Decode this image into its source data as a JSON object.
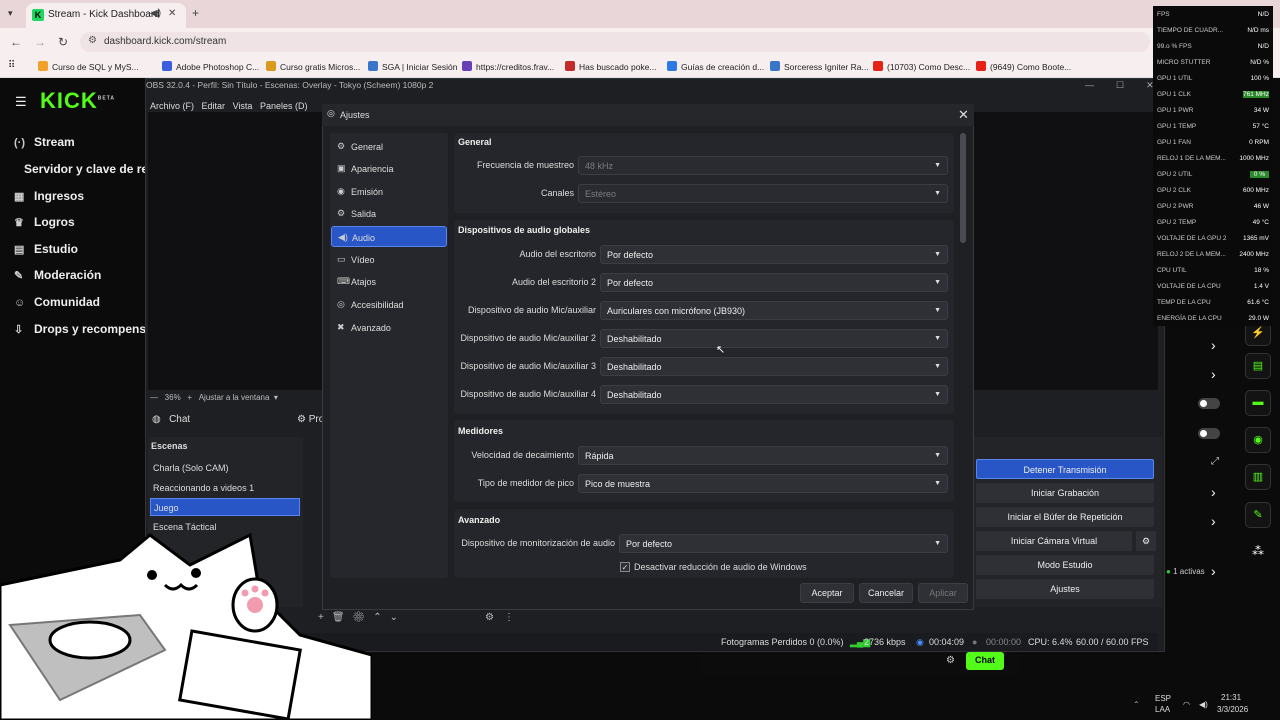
{
  "browser": {
    "tab_title": "Stream - Kick Dashboard",
    "tab_icon": "kick-favicon",
    "url": "dashboard.kick.com/stream",
    "bookmarks": [
      {
        "label": "Curso de SQL y MyS...",
        "color": "#f2a22a"
      },
      {
        "label": "Adobe Photoshop C...",
        "color": "#3b5fdc"
      },
      {
        "label": "Curso gratis Micros...",
        "color": "#d99a1e"
      },
      {
        "label": "SGA | Iniciar Sesión",
        "color": "#3a76c8"
      },
      {
        "label": "https://creditos.frav...",
        "color": "#6a3fb5"
      },
      {
        "label": "Has buscado poke...",
        "color": "#c32a2a"
      },
      {
        "label": "Guías de creación d...",
        "color": "#2c7be5"
      },
      {
        "label": "Sorceress Igniter Ra...",
        "color": "#3a76c8"
      },
      {
        "label": "(10703) Como Desc...",
        "color": "#e62117"
      },
      {
        "label": "(9649) Como Boote...",
        "color": "#e62117"
      }
    ]
  },
  "kick": {
    "logo": "KICK",
    "beta": "BETA",
    "nav": [
      {
        "icon": "stream-icon",
        "glyph": "(·)",
        "label": "Stream"
      },
      {
        "icon": "key-icon",
        "glyph": "",
        "label": "Servidor y clave de retra"
      },
      {
        "icon": "revenue-icon",
        "glyph": "▦",
        "label": "Ingresos"
      },
      {
        "icon": "trophy-icon",
        "glyph": "♛",
        "label": "Logros"
      },
      {
        "icon": "studio-icon",
        "glyph": "▤",
        "label": "Estudio"
      },
      {
        "icon": "wrench-icon",
        "glyph": "✎",
        "label": "Moderación"
      },
      {
        "icon": "community-icon",
        "glyph": "☺",
        "label": "Comunidad"
      },
      {
        "icon": "drops-icon",
        "glyph": "⇩",
        "label": "Drops y recompensas"
      }
    ]
  },
  "obs": {
    "title": "OBS 32.0.4 - Perfil: Sin Título - Escenas: Overlay - Tokyo (Scheem) 1080p 2",
    "menu": [
      "Archivo (F)",
      "Editar",
      "Vista",
      "Paneles (D)"
    ],
    "zoom_text": "36%",
    "fit_text": "Ajustar a la ventana",
    "chat_dock": "Chat",
    "props_dock": "Pro",
    "scenes_header": "Escenas",
    "scenes": [
      "Charla (Solo CAM)",
      "Reaccionando a videos 1",
      "Juego",
      "Escena Táctical"
    ],
    "active_scene": "Juego",
    "controls": [
      "Detener Transmisión",
      "Iniciar Grabación",
      "Iniciar el Búfer de Repetición",
      "Iniciar Cámara Virtual",
      "Modo Estudio",
      "Ajustes"
    ],
    "status": {
      "dropped": "Fotogramas Perdidos 0 (0.0%)",
      "bitrate": "2736 kbps",
      "stream_time": "00:04:09",
      "rec_time": "00:00:00",
      "cpu": "CPU: 6.4%",
      "fps": "60.00 / 60.00 FPS"
    },
    "chat_button": "Chat",
    "active_count": "1 activas"
  },
  "dialog": {
    "title": "Ajustes",
    "sidebar": [
      {
        "icon": "gear-icon",
        "glyph": "⚙",
        "label": "General"
      },
      {
        "icon": "appearance-icon",
        "glyph": "▣",
        "label": "Apariencia"
      },
      {
        "icon": "broadcast-icon",
        "glyph": "◉",
        "label": "Emisión"
      },
      {
        "icon": "output-icon",
        "glyph": "⚙",
        "label": "Salida"
      },
      {
        "icon": "speaker-icon",
        "glyph": "◀)",
        "label": "Audio"
      },
      {
        "icon": "monitor-icon",
        "glyph": "▭",
        "label": "Vídeo"
      },
      {
        "icon": "keyboard-icon",
        "glyph": "⌨",
        "label": "Atajos"
      },
      {
        "icon": "accessibility-icon",
        "glyph": "◎",
        "label": "Accesibilidad"
      },
      {
        "icon": "tools-icon",
        "glyph": "✖",
        "label": "Avanzado"
      }
    ],
    "active_item": "Audio",
    "general": {
      "header": "General",
      "sample_rate_label": "Frecuencia de muestreo",
      "sample_rate_value": "48 kHz",
      "channels_label": "Canales",
      "channels_value": "Estéreo"
    },
    "global_devices": {
      "header": "Dispositivos de audio globales",
      "rows": [
        {
          "label": "Audio del escritorio",
          "value": "Por defecto"
        },
        {
          "label": "Audio del escritorio 2",
          "value": "Por defecto"
        },
        {
          "label": "Dispositivo de audio Mic/auxiliar",
          "value": "Auriculares con micrófono (JB930)"
        },
        {
          "label": "Dispositivo de audio Mic/auxiliar 2",
          "value": "Deshabilitado"
        },
        {
          "label": "Dispositivo de audio Mic/auxiliar 3",
          "value": "Deshabilitado"
        },
        {
          "label": "Dispositivo de audio Mic/auxiliar 4",
          "value": "Deshabilitado"
        }
      ]
    },
    "meters": {
      "header": "Medidores",
      "decay_label": "Velocidad de decaimiento",
      "decay_value": "Rápida",
      "peak_label": "Tipo de medidor de pico",
      "peak_value": "Pico de muestra"
    },
    "advanced": {
      "header": "Avanzado",
      "monitor_label": "Dispositivo de monitorización de audio",
      "monitor_value": "Por defecto",
      "ducking_label": "Desactivar reducción de audio de Windows",
      "ducking_checked": true
    },
    "buttons": {
      "accept": "Aceptar",
      "cancel": "Cancelar",
      "apply": "Aplicar"
    }
  },
  "overlay_stats": [
    {
      "k": "FPS",
      "v": "N/D"
    },
    {
      "k": "TIEMPO DE CUADR...",
      "v": "N/D ms"
    },
    {
      "k": "99.o % FPS",
      "v": "N/D"
    },
    {
      "k": "MICRO STUTTER",
      "v": "N/D %"
    },
    {
      "k": "GPU 1 UTIL",
      "v": "100 %"
    },
    {
      "k": "GPU 1 CLK",
      "v": "761 MHz"
    },
    {
      "k": "GPU 1 PWR",
      "v": "34 W"
    },
    {
      "k": "GPU 1 TEMP",
      "v": "57 °C"
    },
    {
      "k": "GPU 1 FAN",
      "v": "0 RPM"
    },
    {
      "k": "RELOJ 1 DE LA MEM...",
      "v": "1000 MHz"
    },
    {
      "k": "GPU 2 UTIL",
      "v": "0 %"
    },
    {
      "k": "GPU 2 CLK",
      "v": "600 MHz"
    },
    {
      "k": "GPU 2 PWR",
      "v": "46 W"
    },
    {
      "k": "GPU 2 TEMP",
      "v": "49 °C"
    },
    {
      "k": "VOLTAJE DE LA GPU 2",
      "v": "1365 mV"
    },
    {
      "k": "RELOJ 2 DE LA MEM...",
      "v": "2400 MHz"
    },
    {
      "k": "CPU UTIL",
      "v": "18 %"
    },
    {
      "k": "VOLTAJE DE LA CPU",
      "v": "1.4 V"
    },
    {
      "k": "TEMP DE LA CPU",
      "v": "61.6 °C"
    },
    {
      "k": "ENERGÍA DE LA CPU",
      "v": "29.0 W"
    }
  ],
  "taskbar": {
    "lang": "ESP",
    "region": "LAA",
    "time": "21:31",
    "date": "3/3/2026"
  },
  "colors": {
    "accent": "#2956c6",
    "kick_green": "#53fc18"
  }
}
